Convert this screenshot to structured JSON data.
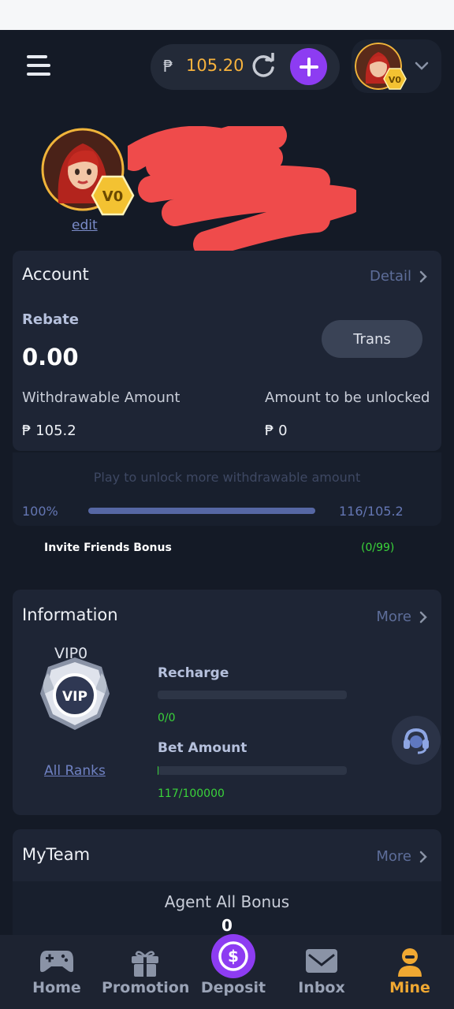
{
  "header": {
    "balance_currency": "₱",
    "balance_value": "105.20",
    "vip_level_badge": "V0"
  },
  "profile": {
    "edit_label": "edit",
    "vip_level_badge": "V0"
  },
  "account": {
    "title": "Account",
    "detail_label": "Detail",
    "rebate_label": "Rebate",
    "rebate_value": "0.00",
    "trans_label": "Trans",
    "withdrawable_label": "Withdrawable Amount",
    "withdrawable_value": "₱ 105.2",
    "unlocked_label": "Amount to be unlocked",
    "unlocked_value": "₱ 0"
  },
  "unlock": {
    "message": "Play to unlock more withdrawable amount",
    "percent": "100%",
    "progress": 1.0,
    "ratio": "116/105.2"
  },
  "invite": {
    "label": "Invite Friends Bonus",
    "count": "(0/99)"
  },
  "information": {
    "title": "Information",
    "more_label": "More",
    "vip_title": "VIP0",
    "vip_badge_text": "VIP",
    "all_ranks_label": "All Ranks",
    "recharge_label": "Recharge",
    "recharge_value": "0/0",
    "recharge_progress": 0.0,
    "bet_label": "Bet Amount",
    "bet_value": "117/100000",
    "bet_progress": 0.00117
  },
  "myteam": {
    "title": "MyTeam",
    "more_label": "More",
    "agent_bonus_label": "Agent All Bonus",
    "agent_bonus_value": "0"
  },
  "nav": {
    "items": [
      {
        "label": "Home",
        "icon": "gamepad-icon"
      },
      {
        "label": "Promotion",
        "icon": "gift-icon"
      },
      {
        "label": "Deposit",
        "icon": "dollar-coin-icon"
      },
      {
        "label": "Inbox",
        "icon": "envelope-icon"
      },
      {
        "label": "Mine",
        "icon": "user-icon"
      }
    ],
    "active": "Mine"
  },
  "colors": {
    "background": "#141a26",
    "card": "#1e2535",
    "accent_purple": "#8d3cf2",
    "balance_gold": "#f6b23d",
    "active_nav": "#f0a832",
    "progress_green": "#3ad33a",
    "redaction": "#ef4b4b"
  }
}
